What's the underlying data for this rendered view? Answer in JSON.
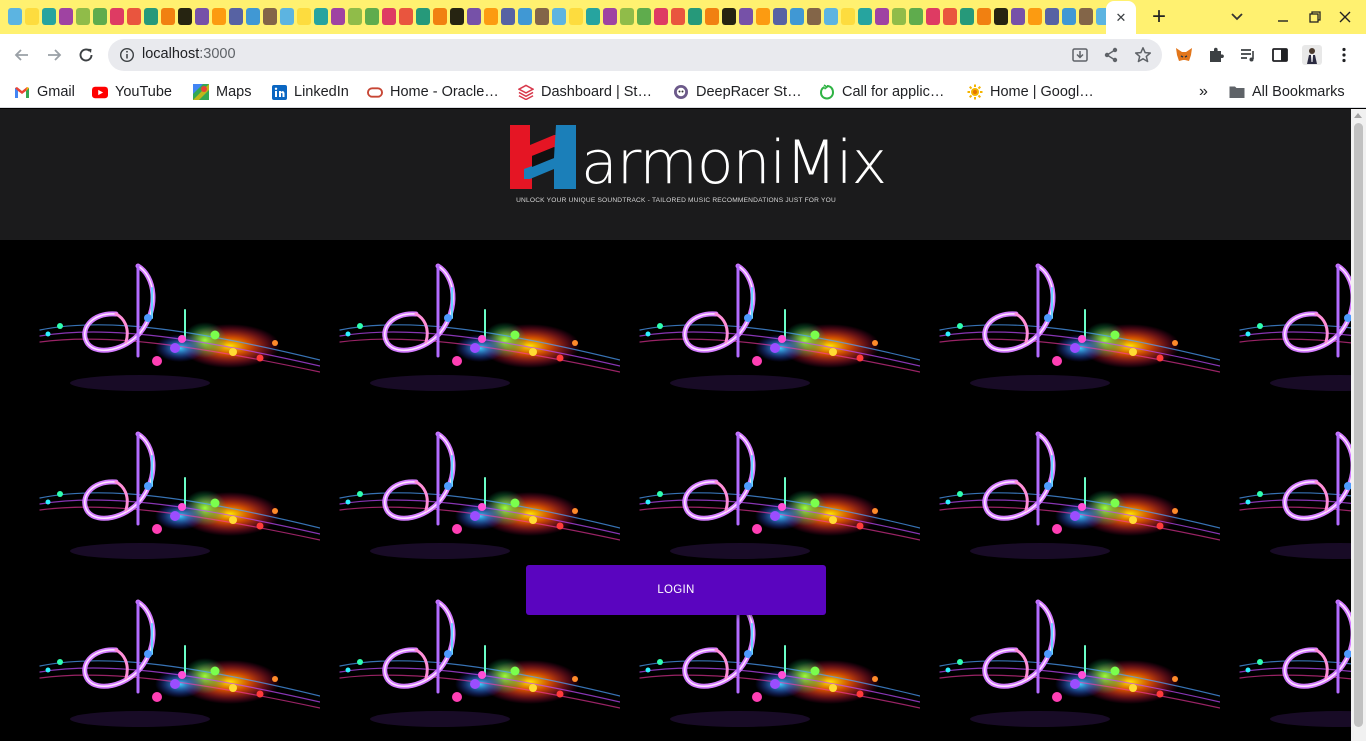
{
  "browser": {
    "active_tab_close": "✕",
    "new_tab": "+",
    "tab_list": "⌄",
    "window_minimize": "—",
    "window_maximize": "❐",
    "window_close": "✕",
    "url_host": "localhost",
    "url_port": ":3000",
    "colors": {
      "tabstrip": "#fff170",
      "omnibox": "#e9eaee"
    }
  },
  "bookmarks": [
    {
      "label": "Gmail",
      "icon": "gmail-icon"
    },
    {
      "label": "YouTube",
      "icon": "youtube-icon"
    },
    {
      "label": "Maps",
      "icon": "maps-icon"
    },
    {
      "label": "LinkedIn",
      "icon": "linkedin-icon"
    },
    {
      "label": "Home - Oracle…",
      "icon": "oracle-icon"
    },
    {
      "label": "Dashboard | St…",
      "icon": "dashboard-icon"
    },
    {
      "label": "DeepRacer St…",
      "icon": "deepracer-icon"
    },
    {
      "label": "Call for applic…",
      "icon": "call-icon"
    },
    {
      "label": "Home | Googl…",
      "icon": "google-icon"
    }
  ],
  "bookmarks_overflow": "»",
  "all_bookmarks": "All Bookmarks",
  "app": {
    "logo_text": "armoniMix",
    "tagline": "UNLOCK YOUR UNIQUE SOUNDTRACK - TAILORED MUSIC RECOMMENDATIONS JUST FOR YOU",
    "login_label": "LOGIN",
    "colors": {
      "header": "#1b1b1c",
      "login": "#5a05bf",
      "logo_red": "#e51524",
      "logo_blue": "#1b7fb9"
    }
  }
}
